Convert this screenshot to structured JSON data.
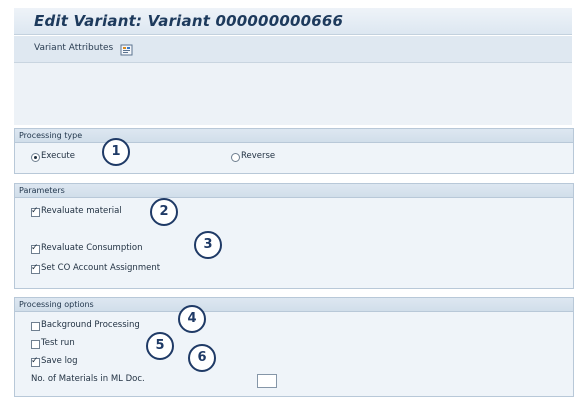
{
  "window": {
    "title": "Edit Variant: Variant 000000000666"
  },
  "toolbar": {
    "variant_attributes_label": "Variant Attributes",
    "attributes_icon": "variant-attributes-icon"
  },
  "processing_type": {
    "title": "Processing type",
    "execute_label": "Execute",
    "reverse_label": "Reverse",
    "selected": "Execute"
  },
  "parameters": {
    "title": "Parameters",
    "revaluate_material": {
      "label": "Revaluate material",
      "checked": true
    },
    "revaluate_consumption": {
      "label": "Revaluate Consumption",
      "checked": true
    },
    "set_co_account": {
      "label": "Set CO Account Assignment",
      "checked": true
    }
  },
  "processing_options": {
    "title": "Processing options",
    "background_processing": {
      "label": "Background Processing",
      "checked": false
    },
    "test_run": {
      "label": "Test run",
      "checked": false
    },
    "save_log": {
      "label": "Save log",
      "checked": true
    },
    "materials_in_ml_doc": {
      "label": "No. of Materials in ML Doc.",
      "value": ""
    }
  },
  "callouts": [
    "1",
    "2",
    "3",
    "4",
    "5",
    "6"
  ],
  "colors": {
    "callout": "#1f3a66",
    "group_bg": "#eff4f9",
    "header_bg": "#dde7f1"
  }
}
